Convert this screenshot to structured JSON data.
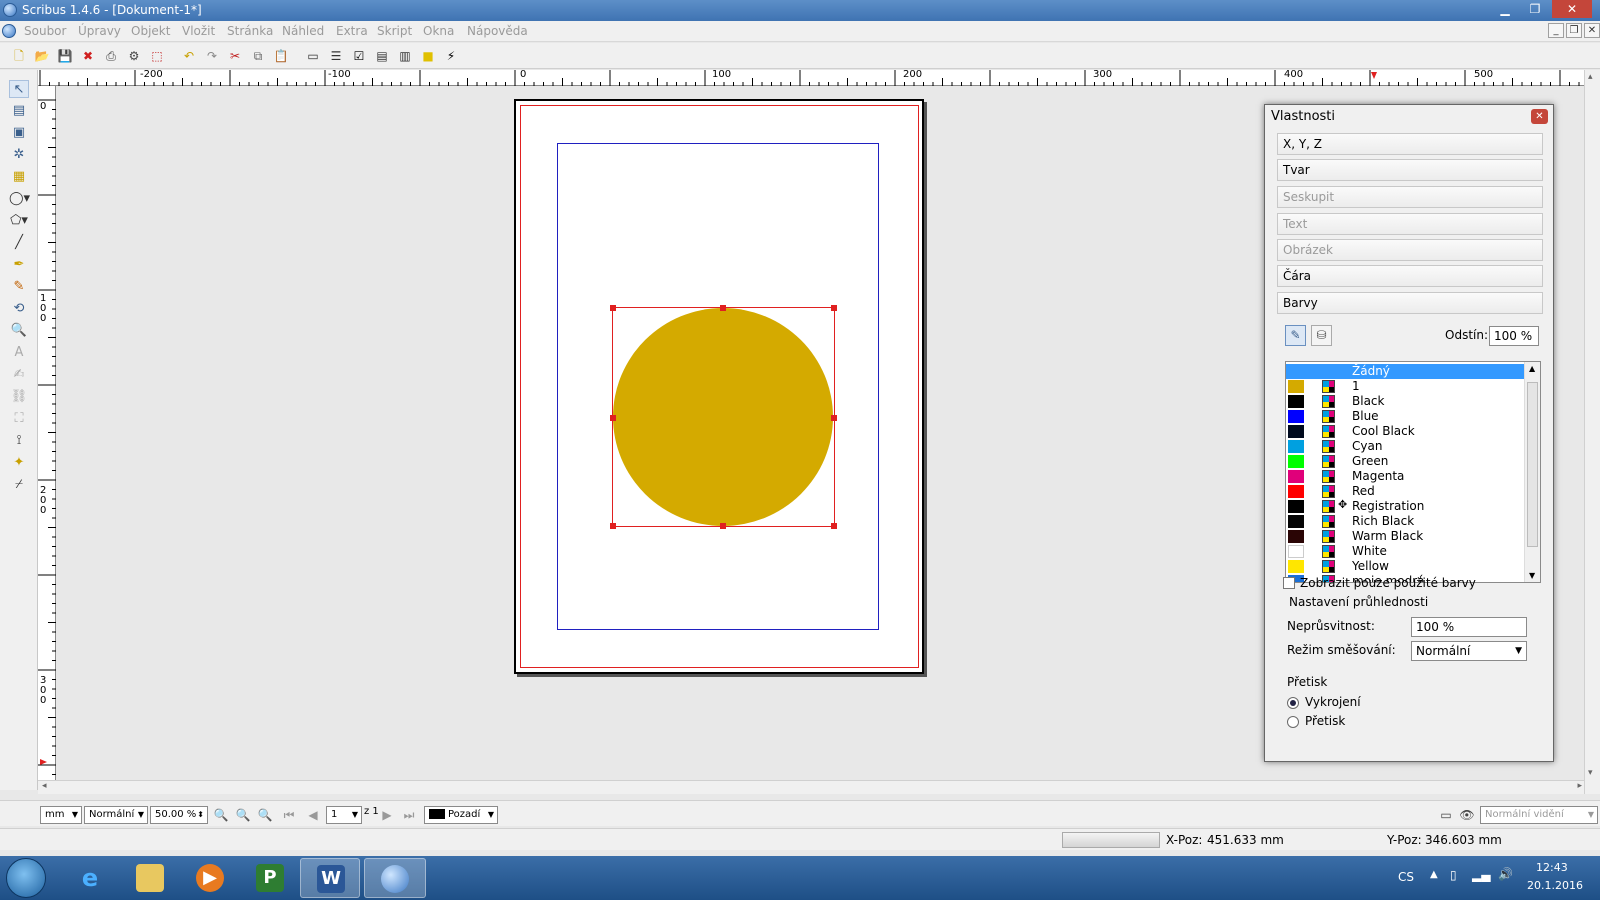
{
  "window": {
    "title": "Scribus 1.4.6 - [Dokument-1*]",
    "min_label": "▁",
    "max_label": "❐",
    "close_label": "✕"
  },
  "menu": [
    "Soubor",
    "Úpravy",
    "Objekt",
    "Vložit",
    "Stránka",
    "Náhled",
    "Extra",
    "Skript",
    "Okna",
    "Nápověda"
  ],
  "ruler": {
    "h_labels": [
      "-200",
      "-100",
      "0",
      "100",
      "200",
      "300",
      "400",
      "500"
    ],
    "v_labels": [
      "0",
      "1\n0\n0",
      "2\n0\n0",
      "3\n0\n0"
    ]
  },
  "canvas": {
    "shape_color": "#d4aa00",
    "bleed_color": "#e02020",
    "margin_color": "#2020c0"
  },
  "properties": {
    "title": "Vlastnosti",
    "sections": [
      {
        "label": "X, Y, Z",
        "enabled": true
      },
      {
        "label": "Tvar",
        "enabled": true
      },
      {
        "label": "Seskupit",
        "enabled": false
      },
      {
        "label": "Text",
        "enabled": false
      },
      {
        "label": "Obrázek",
        "enabled": false
      },
      {
        "label": "Čára",
        "enabled": true
      },
      {
        "label": "Barvy",
        "enabled": true
      }
    ],
    "shade_label": "Odstín:",
    "shade_value": "100 %",
    "colors": [
      {
        "name": "Žádný",
        "swatch": "",
        "selected": true
      },
      {
        "name": "1",
        "swatch": "#d4aa00"
      },
      {
        "name": "Black",
        "swatch": "#000000"
      },
      {
        "name": "Blue",
        "swatch": "#0000ff"
      },
      {
        "name": "Cool Black",
        "swatch": "#000a1e"
      },
      {
        "name": "Cyan",
        "swatch": "#00a0e0"
      },
      {
        "name": "Green",
        "swatch": "#00ff00"
      },
      {
        "name": "Magenta",
        "swatch": "#e0007a"
      },
      {
        "name": "Red",
        "swatch": "#ff0000"
      },
      {
        "name": "Registration",
        "swatch": "#000000",
        "registration": true
      },
      {
        "name": "Rich Black",
        "swatch": "#050505"
      },
      {
        "name": "Warm Black",
        "swatch": "#2a0505"
      },
      {
        "name": "White",
        "swatch": "#ffffff"
      },
      {
        "name": "Yellow",
        "swatch": "#ffe600"
      },
      {
        "name": "moje modrá",
        "swatch": "#1a6fd6"
      }
    ],
    "show_used_only": "Zobrazit pouze použité barvy",
    "transparency_group": "Nastavení průhlednosti",
    "opacity_label": "Neprůsvitnost:",
    "opacity_value": "100 %",
    "blend_label": "Režim směšování:",
    "blend_value": "Normální",
    "overprint_group": "Přetisk",
    "knockout_label": "Vykrojení",
    "overprint_label": "Přetisk"
  },
  "bottom": {
    "unit": "mm",
    "mode": "Normální",
    "zoom": "50.00 %",
    "page": "1",
    "of_label": "z 1",
    "layer": "Pozadí",
    "view_mode": "Normální vidění"
  },
  "status": {
    "x_label": "X-Poz:",
    "x_value": "451.633 mm",
    "y_label": "Y-Poz:",
    "y_value": "346.603 mm"
  },
  "taskbar": {
    "lang": "CS",
    "time": "12:43",
    "date": "20.1.2016"
  }
}
